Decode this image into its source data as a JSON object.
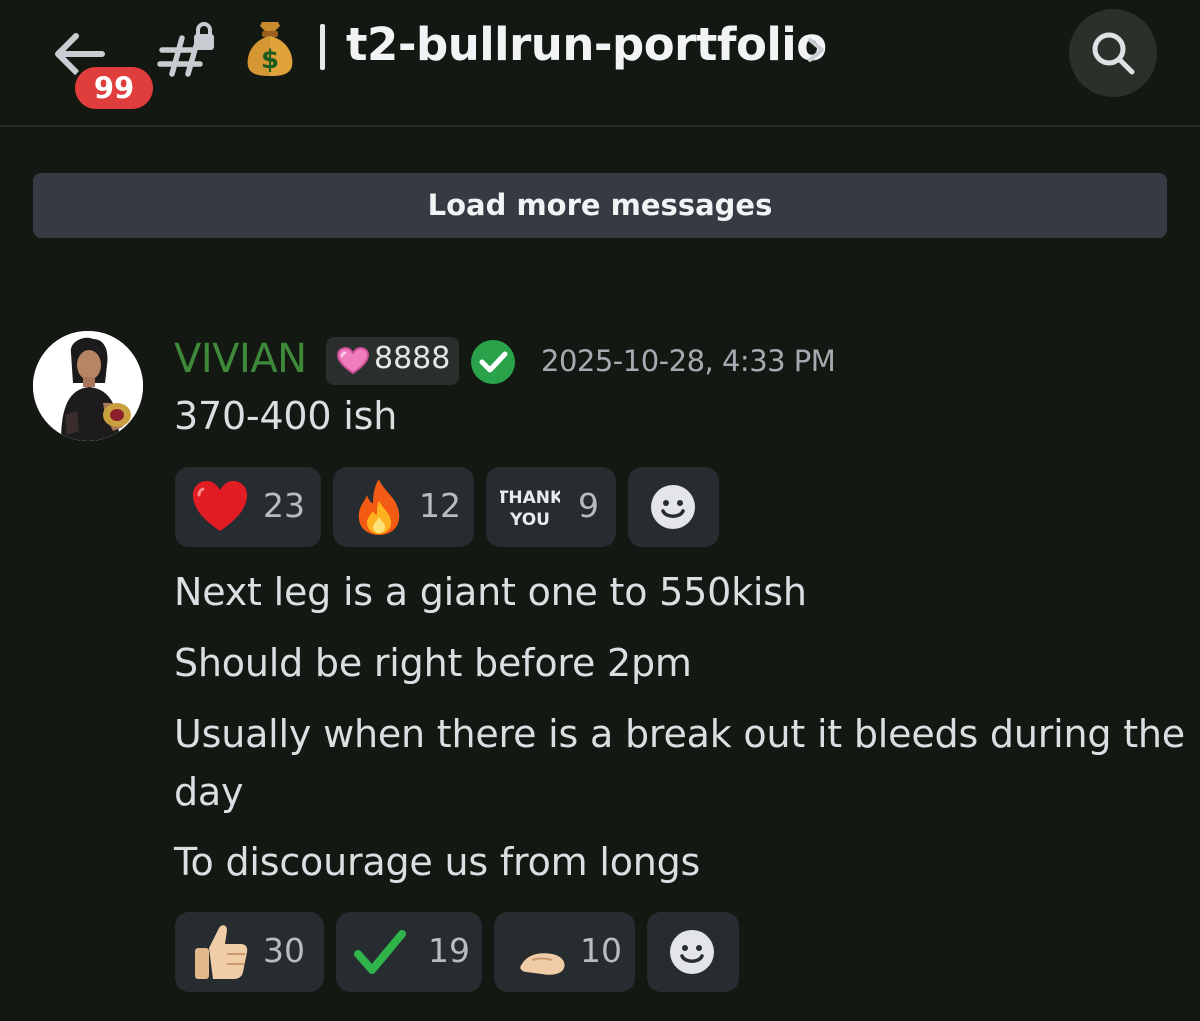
{
  "header": {
    "back_icon": "arrow-left-icon",
    "unread_count": "99",
    "channel_icon": "locked-hash-icon",
    "channel_emoji": "money-bag-emoji",
    "channel_name": "t2-bullrun-portfolio",
    "chevron_icon": "chevron-right-icon",
    "search_icon": "search-icon"
  },
  "load_more_label": "Load more messages",
  "message": {
    "author": "VIVIAN",
    "author_color": "#3f8a3a",
    "tag": {
      "icon": "pink-heart-icon",
      "text": "8888"
    },
    "verified_icon": "verified-check-icon",
    "timestamp": "2025-10-28, 4:33 PM",
    "lines": [
      "370-400 ish",
      "Next leg is a giant one to 550kish",
      "Should be right before 2pm",
      "Usually when there is a break out it bleeds during the",
      "day",
      "To discourage us from longs"
    ],
    "reactions_group_1": [
      {
        "emoji": "red-heart",
        "count": "23"
      },
      {
        "emoji": "fire",
        "count": "12"
      },
      {
        "emoji": "thank-you-sticker",
        "emoji_text_1": "THANK",
        "emoji_text_2": "YOU",
        "count": "9"
      }
    ],
    "reactions_group_2": [
      {
        "emoji": "thumbs-up",
        "count": "30"
      },
      {
        "emoji": "green-check",
        "count": "19"
      },
      {
        "emoji": "writing-hand",
        "count": "10"
      }
    ],
    "add_reaction_icon": "add-reaction-smiley-icon"
  },
  "colors": {
    "background": "#131812",
    "badge_red": "#e03d3d",
    "reaction_bg": "#272c30",
    "load_more_bg": "#363b43",
    "verified_green": "#2aa24a"
  }
}
